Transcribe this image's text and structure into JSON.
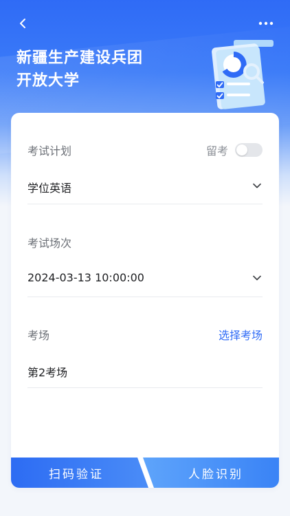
{
  "header": {
    "title_line1": "新疆生产建设兵团",
    "title_line2": "开放大学",
    "back_icon": "chevron-left-icon",
    "more_icon": "more-dots-icon"
  },
  "form": {
    "exam_plan": {
      "label": "考试计划",
      "value": "学位英语"
    },
    "retake": {
      "label": "留考",
      "enabled": false
    },
    "exam_session": {
      "label": "考试场次",
      "value": "2024-03-13 10:00:00"
    },
    "exam_venue": {
      "label": "考场",
      "action": "选择考场",
      "value": "第2考场"
    }
  },
  "actions": {
    "scan_verify": "扫码验证",
    "face_recognition": "人脸识别"
  },
  "colors": {
    "primary": "#2f6bf6",
    "link": "#2f6bf6",
    "background": "#f3f6fb"
  }
}
